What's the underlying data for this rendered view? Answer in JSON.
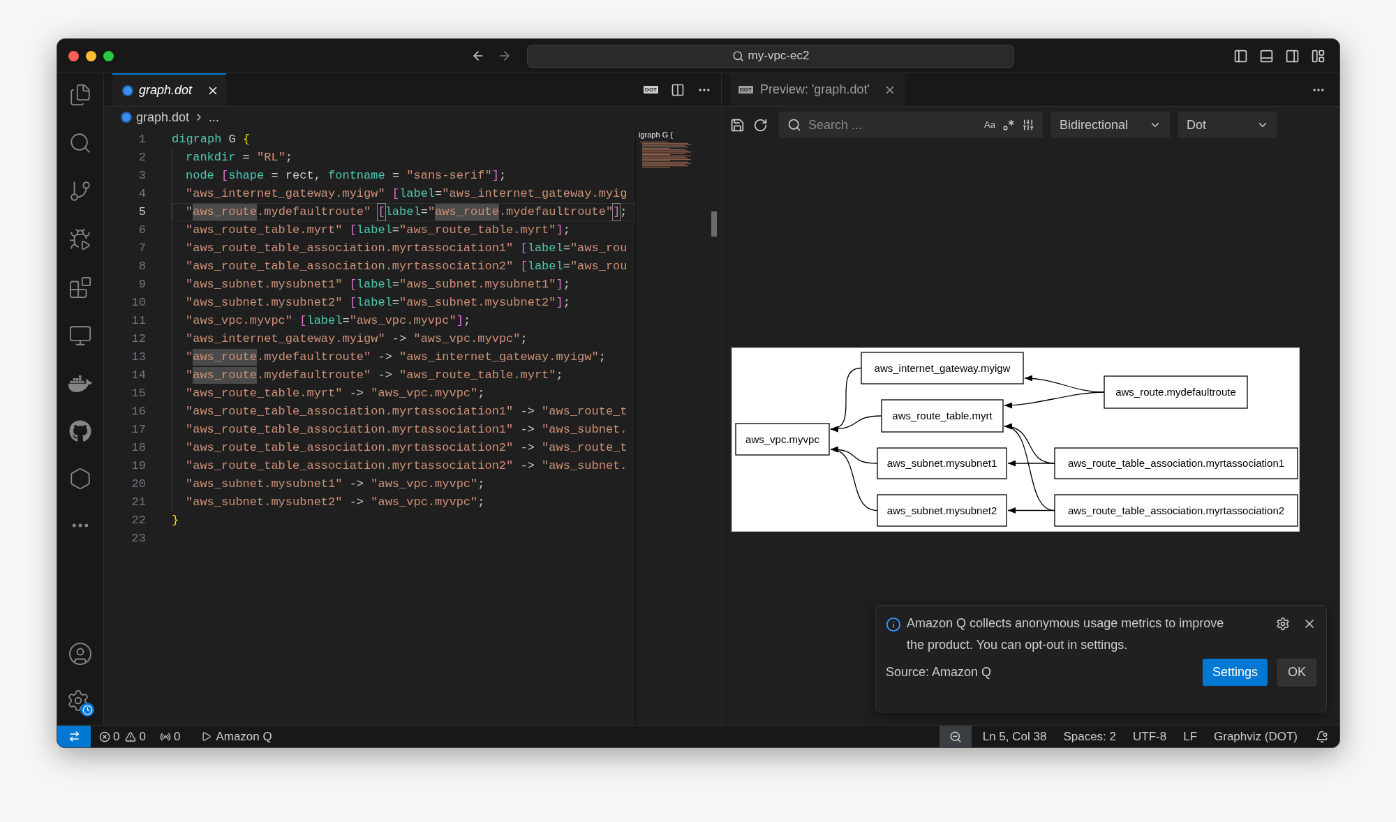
{
  "window": {
    "title": "my-vpc-ec2"
  },
  "editor": {
    "tab": {
      "label": "graph.dot",
      "preview": true
    },
    "action_badge": "DOT",
    "breadcrumb": [
      "graph.dot",
      "..."
    ],
    "lines": [
      {
        "number": "1",
        "indent": false,
        "current": false,
        "tokens": [
          {
            "text": "digraph",
            "kind": "keyword"
          },
          {
            "text": " G ",
            "kind": "plain"
          },
          {
            "text": "{",
            "kind": "brace"
          }
        ]
      },
      {
        "number": "2",
        "indent": true,
        "current": false,
        "tokens": [
          {
            "text": "rankdir",
            "kind": "keyword"
          },
          {
            "text": " = ",
            "kind": "plain"
          },
          {
            "text": "\"RL\"",
            "kind": "string"
          },
          {
            "text": ";",
            "kind": "plain"
          }
        ]
      },
      {
        "number": "3",
        "indent": true,
        "current": false,
        "tokens": [
          {
            "text": "node ",
            "kind": "keyword"
          },
          {
            "text": "[",
            "kind": "bracket"
          },
          {
            "text": "shape",
            "kind": "keyword"
          },
          {
            "text": " = rect, ",
            "kind": "plain"
          },
          {
            "text": "fontname",
            "kind": "keyword"
          },
          {
            "text": " = ",
            "kind": "plain"
          },
          {
            "text": "\"sans-serif\"",
            "kind": "string"
          },
          {
            "text": "]",
            "kind": "bracket"
          },
          {
            "text": ";",
            "kind": "plain"
          }
        ]
      },
      {
        "number": "4",
        "indent": true,
        "current": false,
        "tokens": [
          {
            "text": "\"aws_internet_gateway.myigw\" ",
            "kind": "string"
          },
          {
            "text": "[",
            "kind": "bracket"
          },
          {
            "text": "label",
            "kind": "keyword"
          },
          {
            "text": "=",
            "kind": "plain"
          },
          {
            "text": "\"aws_internet_gateway.myig",
            "kind": "string"
          }
        ]
      },
      {
        "number": "5",
        "indent": true,
        "current": true,
        "tokens": [
          {
            "text": "\"",
            "kind": "string"
          },
          {
            "text": "aws_route",
            "kind": "match"
          },
          {
            "text": ".mydefaultroute\" ",
            "kind": "string"
          },
          {
            "text": "[",
            "kind": "bracket_match"
          },
          {
            "text": "label",
            "kind": "keyword"
          },
          {
            "text": "=",
            "kind": "plain"
          },
          {
            "text": "\"",
            "kind": "string"
          },
          {
            "text": "aws_route",
            "kind": "match"
          },
          {
            "text": ".mydefaultroute\"",
            "kind": "string"
          },
          {
            "text": "]",
            "kind": "bracket_match"
          },
          {
            "text": ";",
            "kind": "plain"
          }
        ]
      },
      {
        "number": "6",
        "indent": true,
        "current": false,
        "tokens": [
          {
            "text": "\"aws_route_table.myrt\" ",
            "kind": "string"
          },
          {
            "text": "[",
            "kind": "bracket"
          },
          {
            "text": "label",
            "kind": "keyword"
          },
          {
            "text": "=",
            "kind": "plain"
          },
          {
            "text": "\"aws_route_table.myrt\"",
            "kind": "string"
          },
          {
            "text": "]",
            "kind": "bracket"
          },
          {
            "text": ";",
            "kind": "plain"
          }
        ]
      },
      {
        "number": "7",
        "indent": true,
        "current": false,
        "tokens": [
          {
            "text": "\"aws_route_table_association.myrtassociation1\" ",
            "kind": "string"
          },
          {
            "text": "[",
            "kind": "bracket"
          },
          {
            "text": "label",
            "kind": "keyword"
          },
          {
            "text": "=",
            "kind": "plain"
          },
          {
            "text": "\"aws_rou",
            "kind": "string"
          }
        ]
      },
      {
        "number": "8",
        "indent": true,
        "current": false,
        "tokens": [
          {
            "text": "\"aws_route_table_association.myrtassociation2\" ",
            "kind": "string"
          },
          {
            "text": "[",
            "kind": "bracket"
          },
          {
            "text": "label",
            "kind": "keyword"
          },
          {
            "text": "=",
            "kind": "plain"
          },
          {
            "text": "\"aws_rou",
            "kind": "string"
          }
        ]
      },
      {
        "number": "9",
        "indent": true,
        "current": false,
        "tokens": [
          {
            "text": "\"aws_subnet.mysubnet1\" ",
            "kind": "string"
          },
          {
            "text": "[",
            "kind": "bracket"
          },
          {
            "text": "label",
            "kind": "keyword"
          },
          {
            "text": "=",
            "kind": "plain"
          },
          {
            "text": "\"aws_subnet.mysubnet1\"",
            "kind": "string"
          },
          {
            "text": "]",
            "kind": "bracket"
          },
          {
            "text": ";",
            "kind": "plain"
          }
        ]
      },
      {
        "number": "10",
        "indent": true,
        "current": false,
        "tokens": [
          {
            "text": "\"aws_subnet.mysubnet2\" ",
            "kind": "string"
          },
          {
            "text": "[",
            "kind": "bracket"
          },
          {
            "text": "label",
            "kind": "keyword"
          },
          {
            "text": "=",
            "kind": "plain"
          },
          {
            "text": "\"aws_subnet.mysubnet2\"",
            "kind": "string"
          },
          {
            "text": "]",
            "kind": "bracket"
          },
          {
            "text": ";",
            "kind": "plain"
          }
        ]
      },
      {
        "number": "11",
        "indent": true,
        "current": false,
        "tokens": [
          {
            "text": "\"aws_vpc.myvpc\" ",
            "kind": "string"
          },
          {
            "text": "[",
            "kind": "bracket"
          },
          {
            "text": "label",
            "kind": "keyword"
          },
          {
            "text": "=",
            "kind": "plain"
          },
          {
            "text": "\"aws_vpc.myvpc\"",
            "kind": "string"
          },
          {
            "text": "]",
            "kind": "bracket"
          },
          {
            "text": ";",
            "kind": "plain"
          }
        ]
      },
      {
        "number": "12",
        "indent": true,
        "current": false,
        "tokens": [
          {
            "text": "\"aws_internet_gateway.myigw\"",
            "kind": "string"
          },
          {
            "text": " -> ",
            "kind": "plain"
          },
          {
            "text": "\"aws_vpc.myvpc\"",
            "kind": "string"
          },
          {
            "text": ";",
            "kind": "plain"
          }
        ]
      },
      {
        "number": "13",
        "indent": true,
        "current": false,
        "tokens": [
          {
            "text": "\"",
            "kind": "string"
          },
          {
            "text": "aws_route",
            "kind": "match"
          },
          {
            "text": ".mydefaultroute\"",
            "kind": "string"
          },
          {
            "text": " -> ",
            "kind": "plain"
          },
          {
            "text": "\"aws_internet_gateway.myigw\"",
            "kind": "string"
          },
          {
            "text": ";",
            "kind": "plain"
          }
        ]
      },
      {
        "number": "14",
        "indent": true,
        "current": false,
        "tokens": [
          {
            "text": "\"",
            "kind": "string"
          },
          {
            "text": "aws_route",
            "kind": "match"
          },
          {
            "text": ".mydefaultroute\"",
            "kind": "string"
          },
          {
            "text": " -> ",
            "kind": "plain"
          },
          {
            "text": "\"aws_route_table.myrt\"",
            "kind": "string"
          },
          {
            "text": ";",
            "kind": "plain"
          }
        ]
      },
      {
        "number": "15",
        "indent": true,
        "current": false,
        "tokens": [
          {
            "text": "\"aws_route_table.myrt\"",
            "kind": "string"
          },
          {
            "text": " -> ",
            "kind": "plain"
          },
          {
            "text": "\"aws_vpc.myvpc\"",
            "kind": "string"
          },
          {
            "text": ";",
            "kind": "plain"
          }
        ]
      },
      {
        "number": "16",
        "indent": true,
        "current": false,
        "tokens": [
          {
            "text": "\"aws_route_table_association.myrtassociation1\"",
            "kind": "string"
          },
          {
            "text": " -> ",
            "kind": "plain"
          },
          {
            "text": "\"aws_route_t",
            "kind": "string"
          }
        ]
      },
      {
        "number": "17",
        "indent": true,
        "current": false,
        "tokens": [
          {
            "text": "\"aws_route_table_association.myrtassociation1\"",
            "kind": "string"
          },
          {
            "text": " -> ",
            "kind": "plain"
          },
          {
            "text": "\"aws_subnet.",
            "kind": "string"
          }
        ]
      },
      {
        "number": "18",
        "indent": true,
        "current": false,
        "tokens": [
          {
            "text": "\"aws_route_table_association.myrtassociation2\"",
            "kind": "string"
          },
          {
            "text": " -> ",
            "kind": "plain"
          },
          {
            "text": "\"aws_route_t",
            "kind": "string"
          }
        ]
      },
      {
        "number": "19",
        "indent": true,
        "current": false,
        "tokens": [
          {
            "text": "\"aws_route_table_association.myrtassociation2\"",
            "kind": "string"
          },
          {
            "text": " -> ",
            "kind": "plain"
          },
          {
            "text": "\"aws_subnet.",
            "kind": "string"
          }
        ]
      },
      {
        "number": "20",
        "indent": true,
        "current": false,
        "tokens": [
          {
            "text": "\"aws_subnet.mysubnet1\"",
            "kind": "string"
          },
          {
            "text": " -> ",
            "kind": "plain"
          },
          {
            "text": "\"aws_vpc.myvpc\"",
            "kind": "string"
          },
          {
            "text": ";",
            "kind": "plain"
          }
        ]
      },
      {
        "number": "21",
        "indent": true,
        "current": false,
        "tokens": [
          {
            "text": "\"aws_subnet.mysubnet2\"",
            "kind": "string"
          },
          {
            "text": " -> ",
            "kind": "plain"
          },
          {
            "text": "\"aws_vpc.myvpc\"",
            "kind": "string"
          },
          {
            "text": ";",
            "kind": "plain"
          }
        ]
      },
      {
        "number": "22",
        "indent": false,
        "current": false,
        "tokens": [
          {
            "text": "}",
            "kind": "brace"
          }
        ]
      },
      {
        "number": "23",
        "current": false
      }
    ],
    "minimap": {
      "sticky_text": "igraph G {"
    }
  },
  "preview": {
    "tab": {
      "badge": "DOT",
      "label": "Preview: 'graph.dot'"
    },
    "search": {
      "placeholder": "Search ..."
    },
    "case_toggle": "Aa",
    "direction": "Bidirectional",
    "engine": "Dot",
    "graph": {
      "nodes": [
        {
          "label": "aws_internet_gateway.myigw"
        },
        {
          "label": "aws_route.mydefaultroute"
        },
        {
          "label": "aws_route_table.myrt"
        },
        {
          "label": "aws_vpc.myvpc"
        },
        {
          "label": "aws_subnet.mysubnet1"
        },
        {
          "label": "aws_route_table_association.myrtassociation1"
        },
        {
          "label": "aws_subnet.mysubnet2"
        },
        {
          "label": "aws_route_table_association.myrtassociation2"
        }
      ]
    }
  },
  "notification": {
    "message": "Amazon Q collects anonymous usage metrics to improve the product. You can opt-out in settings.",
    "source": "Source: Amazon Q",
    "buttons": [
      {
        "label": "Settings",
        "kind": "primary"
      },
      {
        "label": "OK",
        "kind": "secondary"
      }
    ]
  },
  "status_bar": {
    "errors": "0",
    "warnings": "0",
    "ports": "0",
    "amazon_q": "Amazon Q",
    "position": "Ln 5, Col 38",
    "spaces": "Spaces: 2",
    "encoding": "UTF-8",
    "eol": "LF",
    "language": "Graphviz (DOT)"
  }
}
